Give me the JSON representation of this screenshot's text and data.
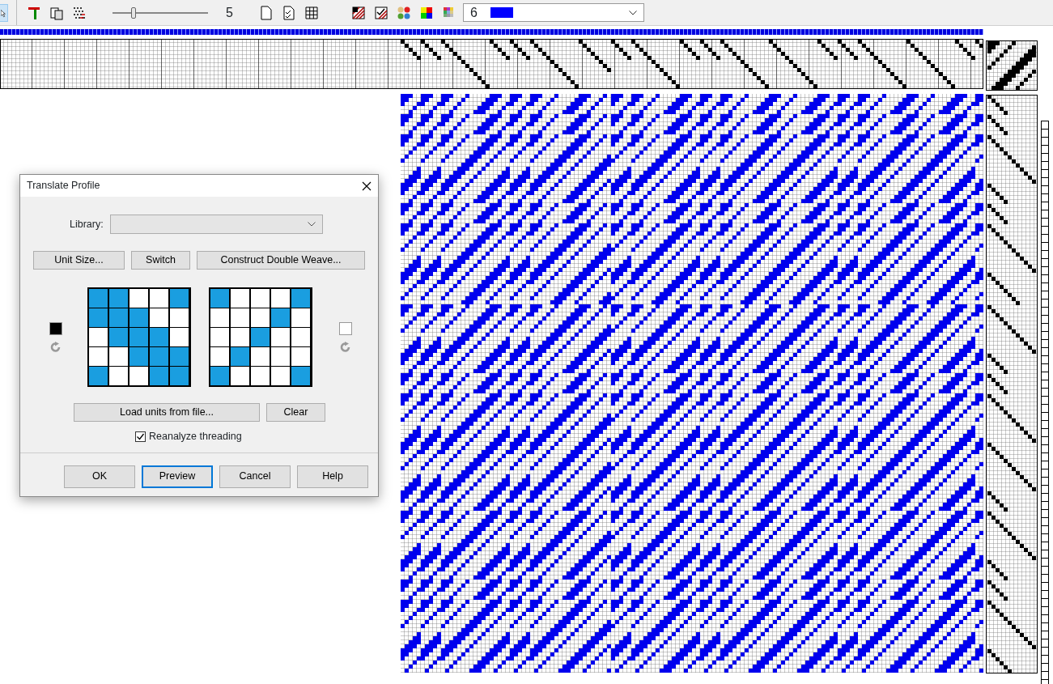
{
  "toolbar": {
    "slider": {
      "level": 0.22,
      "reading": "5"
    },
    "color_select": {
      "value": "6",
      "color": "#0000ff"
    }
  },
  "dialog": {
    "title": "Translate Profile",
    "library": {
      "label": "Library:"
    },
    "top_buttons": [
      "Unit Size...",
      "Switch",
      "Construct Double Weave..."
    ],
    "units": [
      {
        "color": "#000000",
        "rows": [
          [
            {
              "on": true
            },
            {
              "on": true
            },
            {
              "on": false
            },
            {
              "on": false
            },
            {
              "on": true
            }
          ],
          [
            {
              "on": true
            },
            {
              "on": true
            },
            {
              "on": true
            },
            {
              "on": false
            },
            {
              "on": false
            }
          ],
          [
            {
              "on": false
            },
            {
              "on": true
            },
            {
              "on": true
            },
            {
              "on": true
            },
            {
              "on": false
            }
          ],
          [
            {
              "on": false
            },
            {
              "on": false
            },
            {
              "on": true
            },
            {
              "on": true
            },
            {
              "on": true
            }
          ],
          [
            {
              "on": true
            },
            {
              "on": false
            },
            {
              "on": false
            },
            {
              "on": true
            },
            {
              "on": true
            }
          ]
        ]
      },
      {
        "color": "#ffffff",
        "rows": [
          [
            {
              "on": true
            },
            {
              "on": false
            },
            {
              "on": false
            },
            {
              "on": false
            },
            {
              "on": true
            }
          ],
          [
            {
              "on": false
            },
            {
              "on": false
            },
            {
              "on": false
            },
            {
              "on": true
            },
            {
              "on": false
            }
          ],
          [
            {
              "on": false
            },
            {
              "on": false
            },
            {
              "on": true
            },
            {
              "on": false
            },
            {
              "on": false
            }
          ],
          [
            {
              "on": false
            },
            {
              "on": true
            },
            {
              "on": false
            },
            {
              "on": false
            },
            {
              "on": false
            }
          ],
          [
            {
              "on": true
            },
            {
              "on": false
            },
            {
              "on": false
            },
            {
              "on": false
            },
            {
              "on": true
            }
          ]
        ]
      }
    ],
    "load_button": "Load units from file...",
    "clear_button": "Clear",
    "reanalyze": {
      "label": "Reanalyze threading",
      "checked": true
    },
    "footer_buttons": [
      {
        "label": "OK",
        "focused": false
      },
      {
        "label": "Preview",
        "focused": true
      },
      {
        "label": "Cancel",
        "focused": false
      },
      {
        "label": "Help",
        "focused": false
      }
    ]
  }
}
